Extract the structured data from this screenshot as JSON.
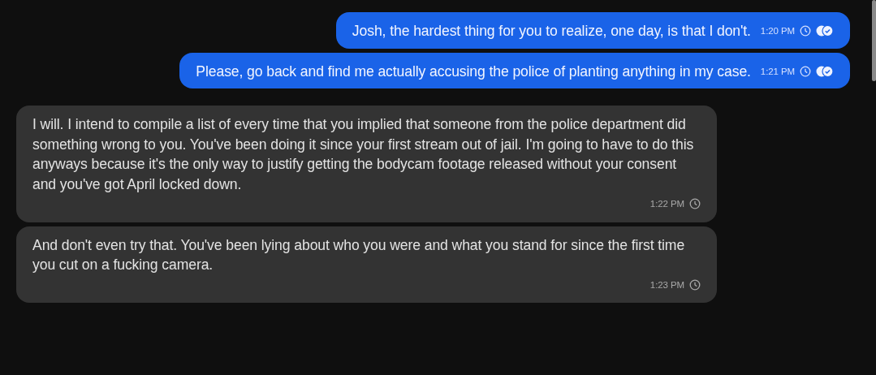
{
  "messages": [
    {
      "kind": "sent",
      "text": "Josh, the hardest thing for you to realize, one day, is that I don't.",
      "time": "1:20 PM"
    },
    {
      "kind": "sent",
      "text": "Please, go back and find me actually accusing the police of planting anything in my case.",
      "time": "1:21 PM"
    },
    {
      "kind": "received",
      "text": "I will. I intend to compile a list of every time that you implied that someone from the police department did something wrong to you. You've been doing it since your first stream out of jail. I'm going to have to do this anyways because it's the only way to justify getting the bodycam footage released without your consent and you've got April locked down.",
      "time": "1:22 PM"
    },
    {
      "kind": "received",
      "text": "And don't even try that. You've been lying about who you were and what you stand for since the first time you cut on a fucking camera.",
      "time": "1:23 PM"
    }
  ]
}
